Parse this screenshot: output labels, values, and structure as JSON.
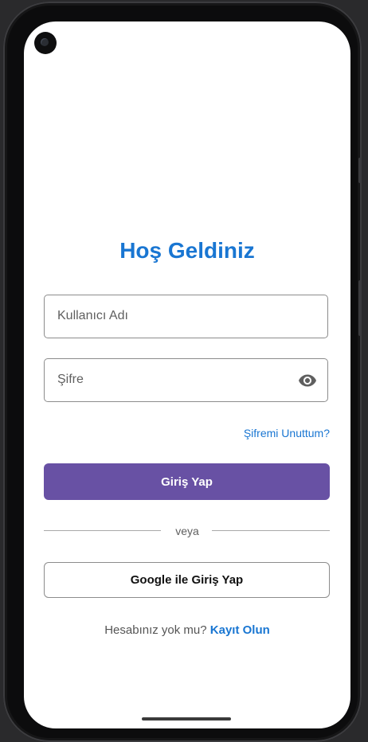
{
  "login": {
    "title": "Hoş Geldiniz",
    "username_placeholder": "Kullanıcı Adı",
    "password_placeholder": "Şifre",
    "forgot_password_link": "Şifremi Unuttum?",
    "login_button": "Giriş Yap",
    "divider_text": "veya",
    "google_button": "Google ile Giriş Yap",
    "signup_prompt": "Hesabınız yok mu?",
    "signup_link": "Kayıt Olun"
  },
  "icons": {
    "password_toggle": "eye-icon"
  },
  "colors": {
    "accent": "#1976d2",
    "primary_button": "#6851a4",
    "background": "#ffffff"
  }
}
